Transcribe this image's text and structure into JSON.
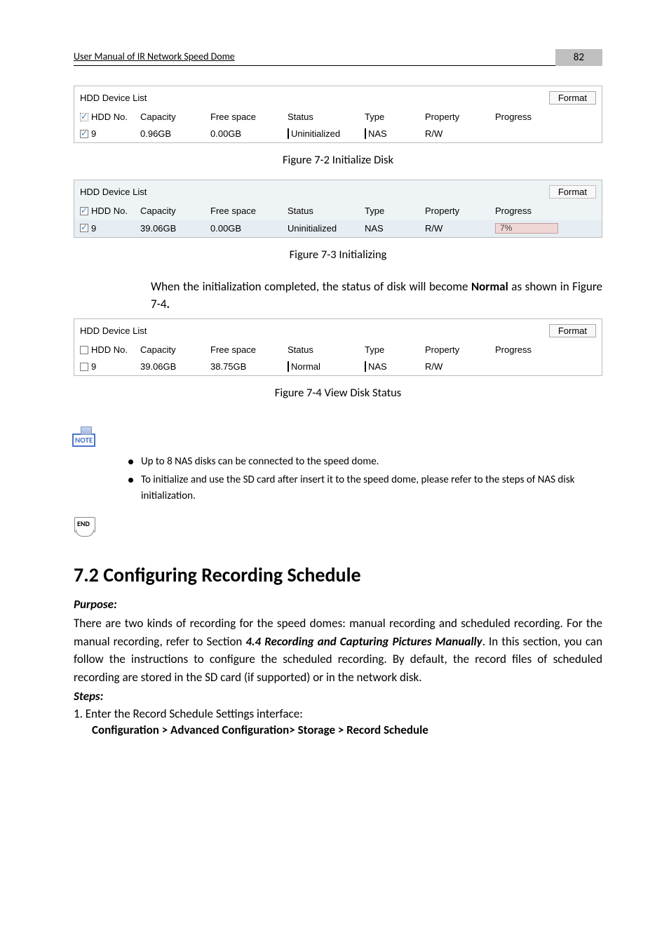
{
  "header": {
    "title": "User Manual of IR Network Speed Dome",
    "page_number": "82"
  },
  "panel1": {
    "title": "HDD Device List",
    "format_label": "Format",
    "headers": {
      "no": "HDD No.",
      "capacity": "Capacity",
      "free": "Free space",
      "status": "Status",
      "type": "Type",
      "property": "Property",
      "progress": "Progress"
    },
    "row": {
      "no": "9",
      "capacity": "0.96GB",
      "free": "0.00GB",
      "status": "Uninitialized",
      "type": "NAS",
      "property": "R/W",
      "progress": ""
    }
  },
  "caption1": "Figure 7-2 Initialize Disk",
  "panel2": {
    "title": "HDD Device List",
    "format_label": "Format",
    "headers": {
      "no": "HDD No.",
      "capacity": "Capacity",
      "free": "Free space",
      "status": "Status",
      "type": "Type",
      "property": "Property",
      "progress": "Progress"
    },
    "row": {
      "no": "9",
      "capacity": "39.06GB",
      "free": "0.00GB",
      "status": "Uninitialized",
      "type": "NAS",
      "property": "R/W",
      "progress_text": "7%"
    }
  },
  "caption2": "Figure 7-3 Initializing",
  "para_after_fig3_a": "When the initialization completed, the status of disk will become ",
  "para_after_fig3_b": "Normal",
  "para_after_fig3_c": " as shown in Figure 7-4",
  "panel3": {
    "title": "HDD Device List",
    "format_label": "Format",
    "headers": {
      "no": "HDD No.",
      "capacity": "Capacity",
      "free": "Free space",
      "status": "Status",
      "type": "Type",
      "property": "Property",
      "progress": "Progress"
    },
    "row": {
      "no": "9",
      "capacity": "39.06GB",
      "free": "38.75GB",
      "status": "Normal",
      "type": "NAS",
      "property": "R/W",
      "progress": ""
    }
  },
  "caption3": "Figure 7-4 View Disk Status",
  "note_label": "NOTE",
  "bullets": [
    "Up to 8 NAS disks can be connected to the speed dome.",
    "To initialize and use the SD card after insert it to the speed dome, please refer to the steps of NAS disk initialization."
  ],
  "end_label": "END",
  "section_heading": "7.2   Configuring Recording Schedule",
  "purpose_label": "Purpose:",
  "purpose_text_a": "There are two kinds of recording for the speed domes: manual recording and scheduled recording. For the manual recording, refer to Section ",
  "purpose_text_b": "4.4 Recording and Capturing Pictures Manually",
  "purpose_text_c": ". In this section, you can follow the instructions to configure the scheduled recording. By default, the record files of scheduled recording are stored in the SD card (if supported) or in the network disk.",
  "steps_label": "Steps:",
  "step1": "1.   Enter the Record Schedule Settings interface:",
  "step1_path": "Configuration > Advanced Configuration> Storage > Record Schedule"
}
